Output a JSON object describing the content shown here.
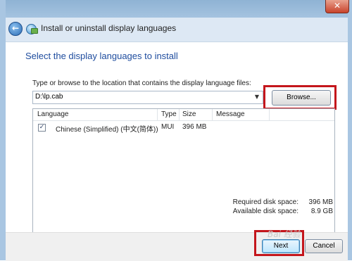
{
  "window": {
    "title": "Install or uninstall display languages",
    "close_glyph": "✕"
  },
  "header": {
    "back_glyph": "←"
  },
  "main": {
    "section_title": "Select the display languages to install",
    "path_label": "Type or browse to the location that contains the display language files:",
    "path_value": "D:\\lp.cab",
    "combo_arrow": "▼",
    "browse_label": "Browse..."
  },
  "list": {
    "columns": [
      "Language",
      "Type",
      "Size",
      "Message"
    ],
    "rows": [
      {
        "checked": "✓",
        "language": "Chinese (Simplified) (中文(简体))",
        "type": "MUI",
        "size": "396 MB",
        "message": ""
      }
    ]
  },
  "disk": {
    "required_label": "Required disk space:",
    "required_value": "396 MB",
    "available_label": "Available disk space:",
    "available_value": "8.9 GB"
  },
  "footer": {
    "next_label": "Next",
    "cancel_label": "Cancel"
  },
  "watermark": {
    "text": "Bai 经验"
  },
  "colors": {
    "highlight": "#c4161c",
    "title_blue": "#1e4c9e",
    "header_bg": "#dde8f4"
  },
  "icons": {
    "back": "back-arrow-icon",
    "app": "globe-icon",
    "close": "close-icon",
    "checkbox": "checkmark-icon",
    "combo": "chevron-down-icon"
  }
}
